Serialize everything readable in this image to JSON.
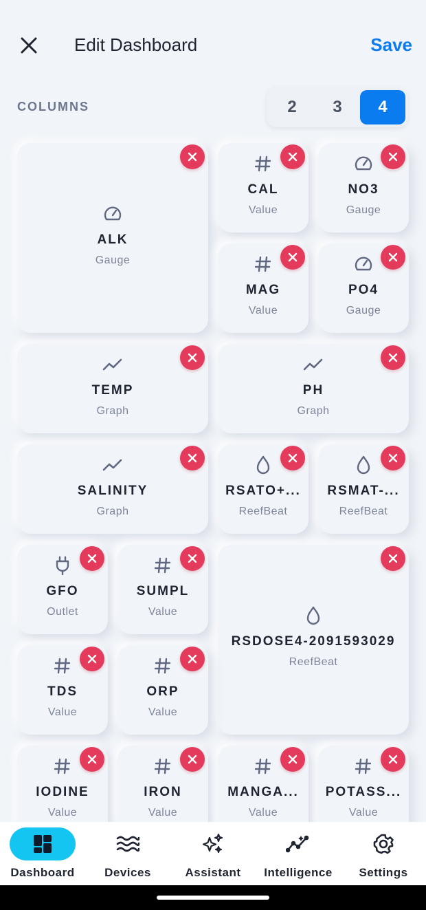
{
  "header": {
    "title": "Edit Dashboard",
    "save_label": "Save"
  },
  "columns": {
    "label": "COLUMNS",
    "options": [
      "2",
      "3",
      "4"
    ],
    "selected": "4"
  },
  "widgets": [
    {
      "name": "ALK",
      "type": "Gauge",
      "icon": "gauge-icon"
    },
    {
      "name": "CAL",
      "type": "Value",
      "icon": "hash-icon"
    },
    {
      "name": "NO3",
      "type": "Gauge",
      "icon": "gauge-icon"
    },
    {
      "name": "MAG",
      "type": "Value",
      "icon": "hash-icon"
    },
    {
      "name": "PO4",
      "type": "Gauge",
      "icon": "gauge-icon"
    },
    {
      "name": "TEMP",
      "type": "Graph",
      "icon": "graph-icon"
    },
    {
      "name": "PH",
      "type": "Graph",
      "icon": "graph-icon"
    },
    {
      "name": "SALINITY",
      "type": "Graph",
      "icon": "graph-icon"
    },
    {
      "name": "RSATO+...",
      "type": "ReefBeat",
      "icon": "drop-icon"
    },
    {
      "name": "RSMAT-...",
      "type": "ReefBeat",
      "icon": "drop-icon"
    },
    {
      "name": "GFO",
      "type": "Outlet",
      "icon": "plug-icon"
    },
    {
      "name": "SUMPL",
      "type": "Value",
      "icon": "hash-icon"
    },
    {
      "name": "RSDOSE4-2091593029",
      "type": "ReefBeat",
      "icon": "drop-icon"
    },
    {
      "name": "TDS",
      "type": "Value",
      "icon": "hash-icon"
    },
    {
      "name": "ORP",
      "type": "Value",
      "icon": "hash-icon"
    },
    {
      "name": "IODINE",
      "type": "Value",
      "icon": "hash-icon"
    },
    {
      "name": "IRON",
      "type": "Value",
      "icon": "hash-icon"
    },
    {
      "name": "MANGA...",
      "type": "Value",
      "icon": "hash-icon"
    },
    {
      "name": "POTASS...",
      "type": "Value",
      "icon": "hash-icon"
    }
  ],
  "tabs": [
    {
      "label": "Dashboard",
      "icon": "dashboard-icon",
      "active": true
    },
    {
      "label": "Devices",
      "icon": "waves-icon",
      "active": false
    },
    {
      "label": "Assistant",
      "icon": "sparkles-icon",
      "active": false
    },
    {
      "label": "Intelligence",
      "icon": "insights-icon",
      "active": false
    },
    {
      "label": "Settings",
      "icon": "gear-icon",
      "active": false
    }
  ],
  "colors": {
    "accent": "#0a7cf0",
    "remove": "#e43b5c",
    "active_tab": "#13c5f0",
    "background": "#f1f4f8"
  }
}
